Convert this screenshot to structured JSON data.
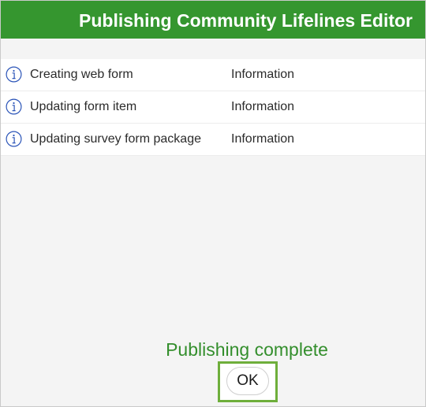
{
  "dialog": {
    "title": "Publishing Community Lifelines Editor"
  },
  "log": {
    "entries": [
      {
        "icon": "info-icon",
        "message": "Creating web form",
        "level": "Information"
      },
      {
        "icon": "info-icon",
        "message": "Updating form item",
        "level": "Information"
      },
      {
        "icon": "info-icon",
        "message": "Updating survey form package",
        "level": "Information"
      }
    ]
  },
  "status": {
    "text": "Publishing complete"
  },
  "buttons": {
    "ok_label": "OK"
  },
  "colors": {
    "title_bar": "#35962f",
    "status_text": "#338e2c",
    "info_icon": "#2c55b8",
    "ok_highlight": "#6eae3b"
  }
}
